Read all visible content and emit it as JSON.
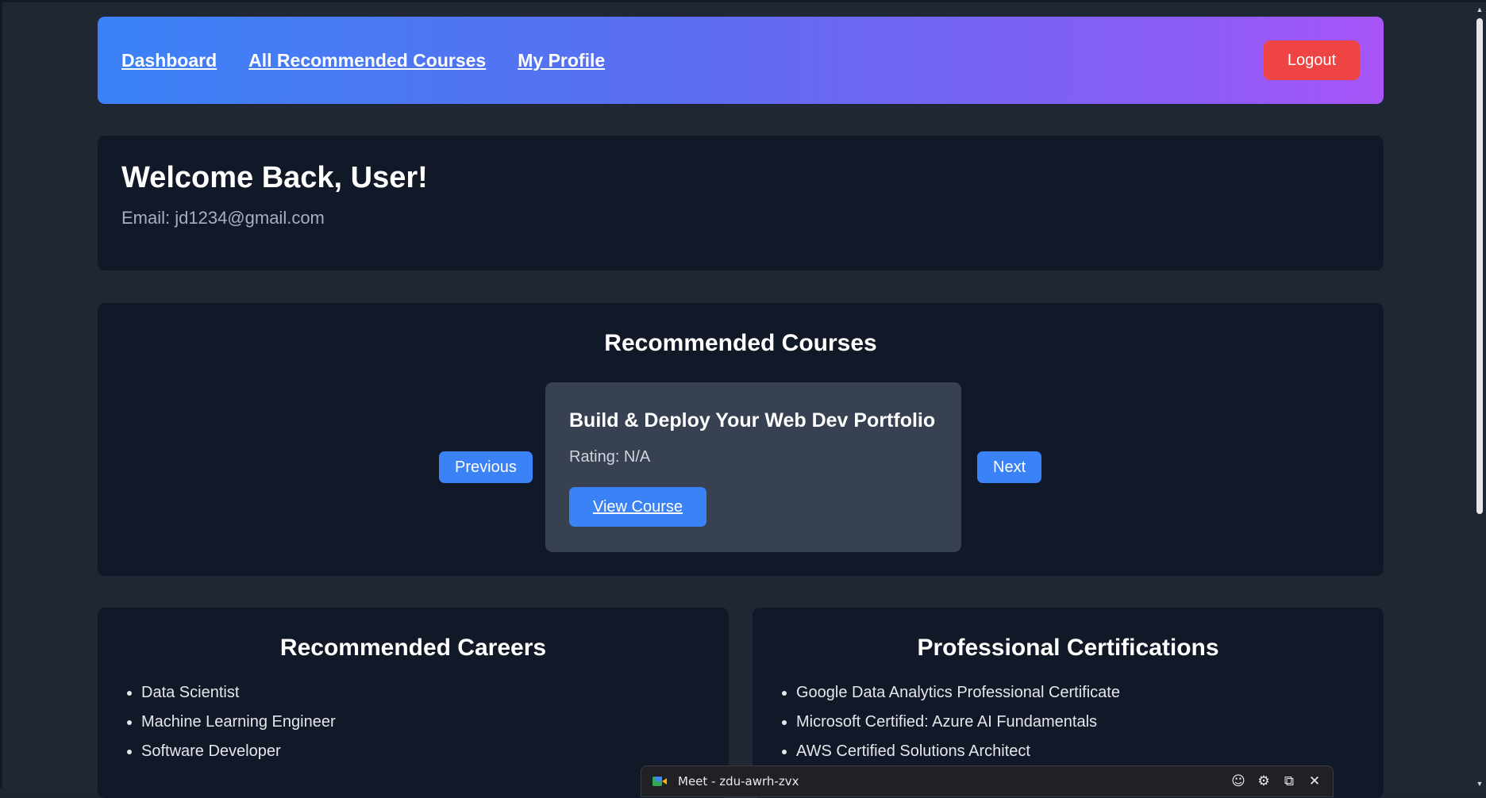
{
  "nav": {
    "links": [
      "Dashboard",
      "All Recommended Courses",
      "My Profile"
    ],
    "logout_label": "Logout"
  },
  "welcome": {
    "title": "Welcome Back, User!",
    "email": "Email: jd1234@gmail.com"
  },
  "courses": {
    "title": "Recommended Courses",
    "prev_label": "Previous",
    "next_label": "Next",
    "current": {
      "title": "Build & Deploy Your Web Dev Portfolio",
      "rating": "Rating: N/A",
      "view_label": "View Course"
    }
  },
  "careers": {
    "title": "Recommended Careers",
    "items": [
      "Data Scientist",
      "Machine Learning Engineer",
      "Software Developer"
    ]
  },
  "certifications": {
    "title": "Professional Certifications",
    "items": [
      "Google Data Analytics Professional Certificate",
      "Microsoft Certified: Azure AI Fundamentals",
      "AWS Certified Solutions Architect"
    ]
  },
  "meet": {
    "title": "Meet - zdu-awrh-zvx",
    "icons": [
      "emoji-icon",
      "gear-icon",
      "open-external-icon",
      "close-icon"
    ]
  },
  "colors": {
    "gradient_start": "#3b82f6",
    "gradient_end": "#a855f7",
    "logout": "#ef4444",
    "primary_button": "#3b82f6",
    "card_bg": "#111827",
    "course_card_bg": "#374151",
    "page_bg": "#1f2733"
  }
}
